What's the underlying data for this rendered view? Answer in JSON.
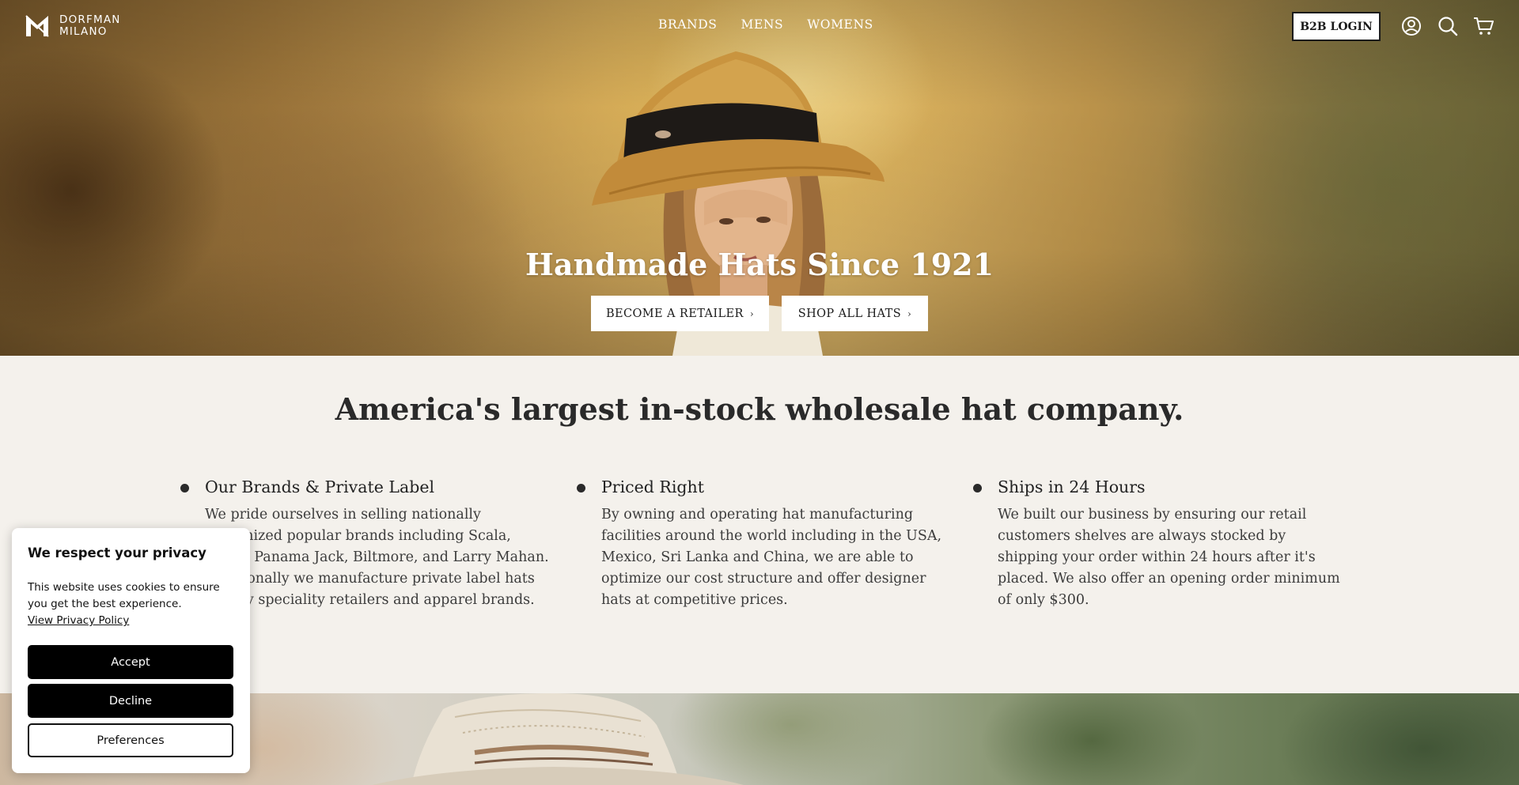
{
  "header": {
    "logo_line1": "DORFMAN",
    "logo_line2": "MILANO",
    "nav": [
      "BRANDS",
      "MENS",
      "WOMENS"
    ],
    "b2b_login": "B2B LOGIN",
    "icons": [
      "account-icon",
      "search-icon",
      "cart-icon"
    ]
  },
  "hero": {
    "title": "Handmade Hats Since 1921",
    "buttons": [
      "BECOME A RETAILER",
      "SHOP ALL HATS"
    ]
  },
  "intro": {
    "title": "America's largest in-stock wholesale hat company.",
    "features": [
      {
        "title": "Our Brands & Private Label",
        "text": "We pride ourselves in selling nationally recognized popular brands including Scala, Justin, Panama Jack, Biltmore, and Larry Mahan. Additionally we manufacture private label hats for key speciality retailers and apparel brands."
      },
      {
        "title": "Priced Right",
        "text": "By owning and operating hat manufacturing facilities around the world including in the USA, Mexico, Sri Lanka and China, we are able to optimize our cost structure and offer designer hats at competitive prices."
      },
      {
        "title": "Ships in 24 Hours",
        "text": "We built our business by ensuring our retail customers shelves are always stocked by shipping your order within 24 hours after it's placed. We also offer an opening order minimum of only $300."
      }
    ]
  },
  "cookie": {
    "title": "We respect your privacy",
    "text": "This website uses cookies to ensure you get the best experience.",
    "link": "View Privacy Policy",
    "accept": "Accept",
    "decline": "Decline",
    "preferences": "Preferences"
  },
  "colors": {
    "text_dark": "#2a2a2a",
    "page_bg": "#f4f1ec",
    "button_dark": "#000000"
  }
}
